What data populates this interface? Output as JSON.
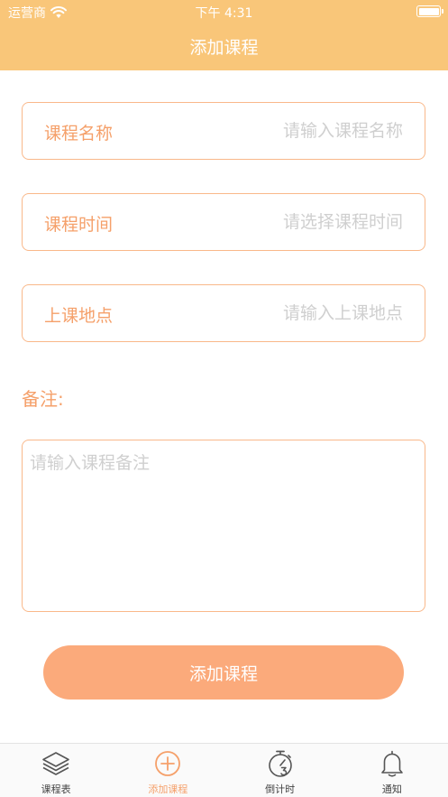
{
  "status_bar": {
    "carrier": "运营商",
    "time": "下午 4:31"
  },
  "nav": {
    "title": "添加课程"
  },
  "form": {
    "fields": [
      {
        "label": "课程名称",
        "placeholder": "请输入课程名称",
        "value": ""
      },
      {
        "label": "课程时间",
        "placeholder": "请选择课程时间",
        "value": ""
      },
      {
        "label": "上课地点",
        "placeholder": "请输入上课地点",
        "value": ""
      }
    ],
    "note_label": "备注:",
    "note_placeholder": "请输入课程备注",
    "submit_label": "添加课程"
  },
  "tabbar": {
    "items": [
      {
        "label": "课程表",
        "icon": "layers-icon",
        "active": false
      },
      {
        "label": "添加课程",
        "icon": "plus-circle-icon",
        "active": true
      },
      {
        "label": "倒计时",
        "icon": "timer-icon",
        "active": false
      },
      {
        "label": "通知",
        "icon": "bell-icon",
        "active": false
      }
    ]
  },
  "colors": {
    "header": "#F9C679",
    "accent": "#F5A06A",
    "border": "#F9B88A",
    "button": "#FBAA7B",
    "placeholder": "#CFCFCF"
  }
}
